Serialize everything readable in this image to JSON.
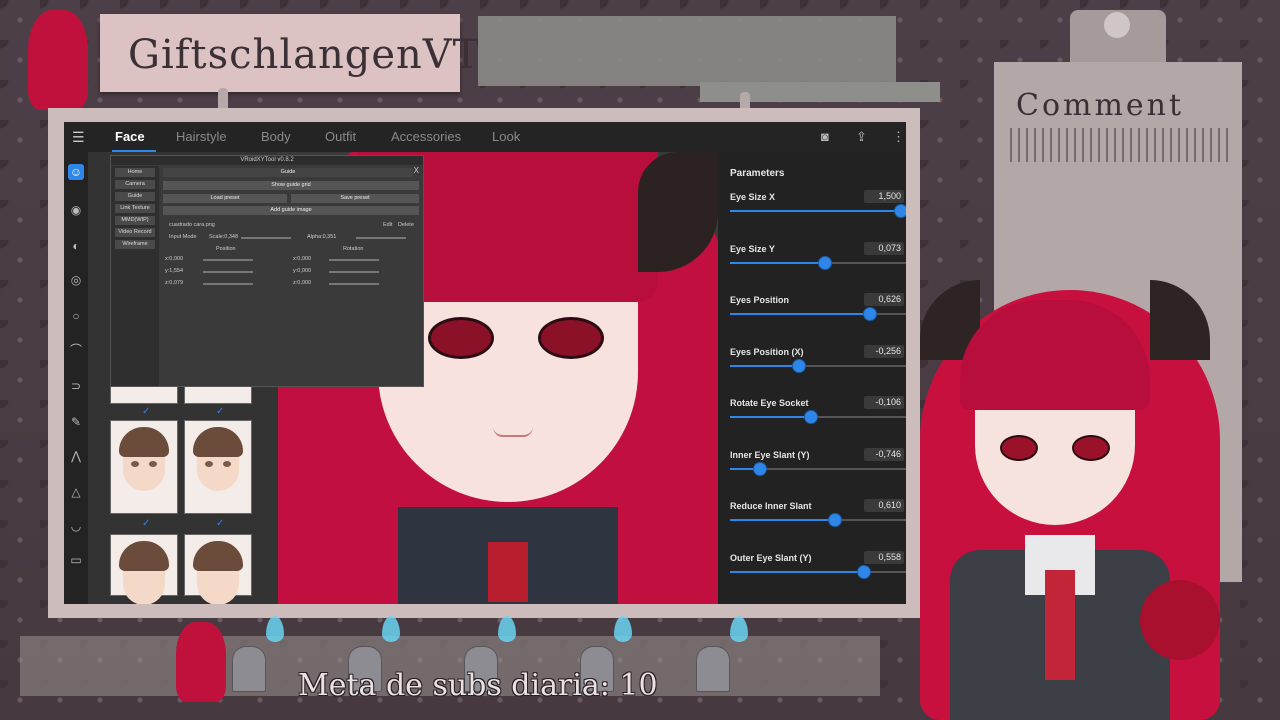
{
  "stream": {
    "channel_name": "GiftschlangenVT",
    "comment_header": "Comment",
    "ticker": "Meta de subs diaria: 10"
  },
  "app": {
    "menu_icon": "hamburger-icon",
    "tabs": [
      "Face",
      "Hairstyle",
      "Body",
      "Outfit",
      "Accessories",
      "Look"
    ],
    "active_tab": "Face",
    "toolbar_icons": [
      "camera-icon",
      "export-icon",
      "more-icon"
    ]
  },
  "tool_window": {
    "title": "VRoidXYTool v0.8.2",
    "close": "X",
    "sidebar": [
      "Home",
      "Camera",
      "Guide",
      "Link Texture",
      "MMD(WIP)",
      "Video Record",
      "Wireframe"
    ],
    "section_title": "Guide",
    "buttons": {
      "show_grid": "Show guide grid",
      "load_preset": "Load preset",
      "save_preset": "Save preset",
      "add_image": "Add guide image"
    },
    "image_file": "cuadrado cara.png",
    "edit_label": "Edit",
    "delete_label": "Delete",
    "input_mode": "Input Mode",
    "scale": "Scale:0,348",
    "alpha": "Alpha:0,351",
    "position_header": "Position",
    "rotation_header": "Rotation",
    "position": [
      "x:0,000",
      "y:1,554",
      "z:0,079"
    ],
    "rotation": [
      "x:0,000",
      "y:0,000",
      "z:0,000"
    ]
  },
  "parameters": {
    "title": "Parameters",
    "items": [
      {
        "label": "Eye Size X",
        "value": "1,500",
        "fraction": 1.0
      },
      {
        "label": "Eye Size Y",
        "value": "0,073",
        "fraction": 0.55
      },
      {
        "label": "Eyes Position",
        "value": "0,626",
        "fraction": 0.82
      },
      {
        "label": "Eyes Position (X)",
        "value": "-0,256",
        "fraction": 0.4
      },
      {
        "label": "Rotate Eye Socket",
        "value": "-0,106",
        "fraction": 0.47
      },
      {
        "label": "Inner Eye Slant (Y)",
        "value": "-0,746",
        "fraction": 0.17
      },
      {
        "label": "Reduce Inner Slant",
        "value": "0,610",
        "fraction": 0.61
      },
      {
        "label": "Outer Eye Slant (Y)",
        "value": "0,558",
        "fraction": 0.78
      }
    ]
  },
  "colors": {
    "accent": "#2d86e8",
    "hair": "#c1103f",
    "panel": "#222222"
  }
}
